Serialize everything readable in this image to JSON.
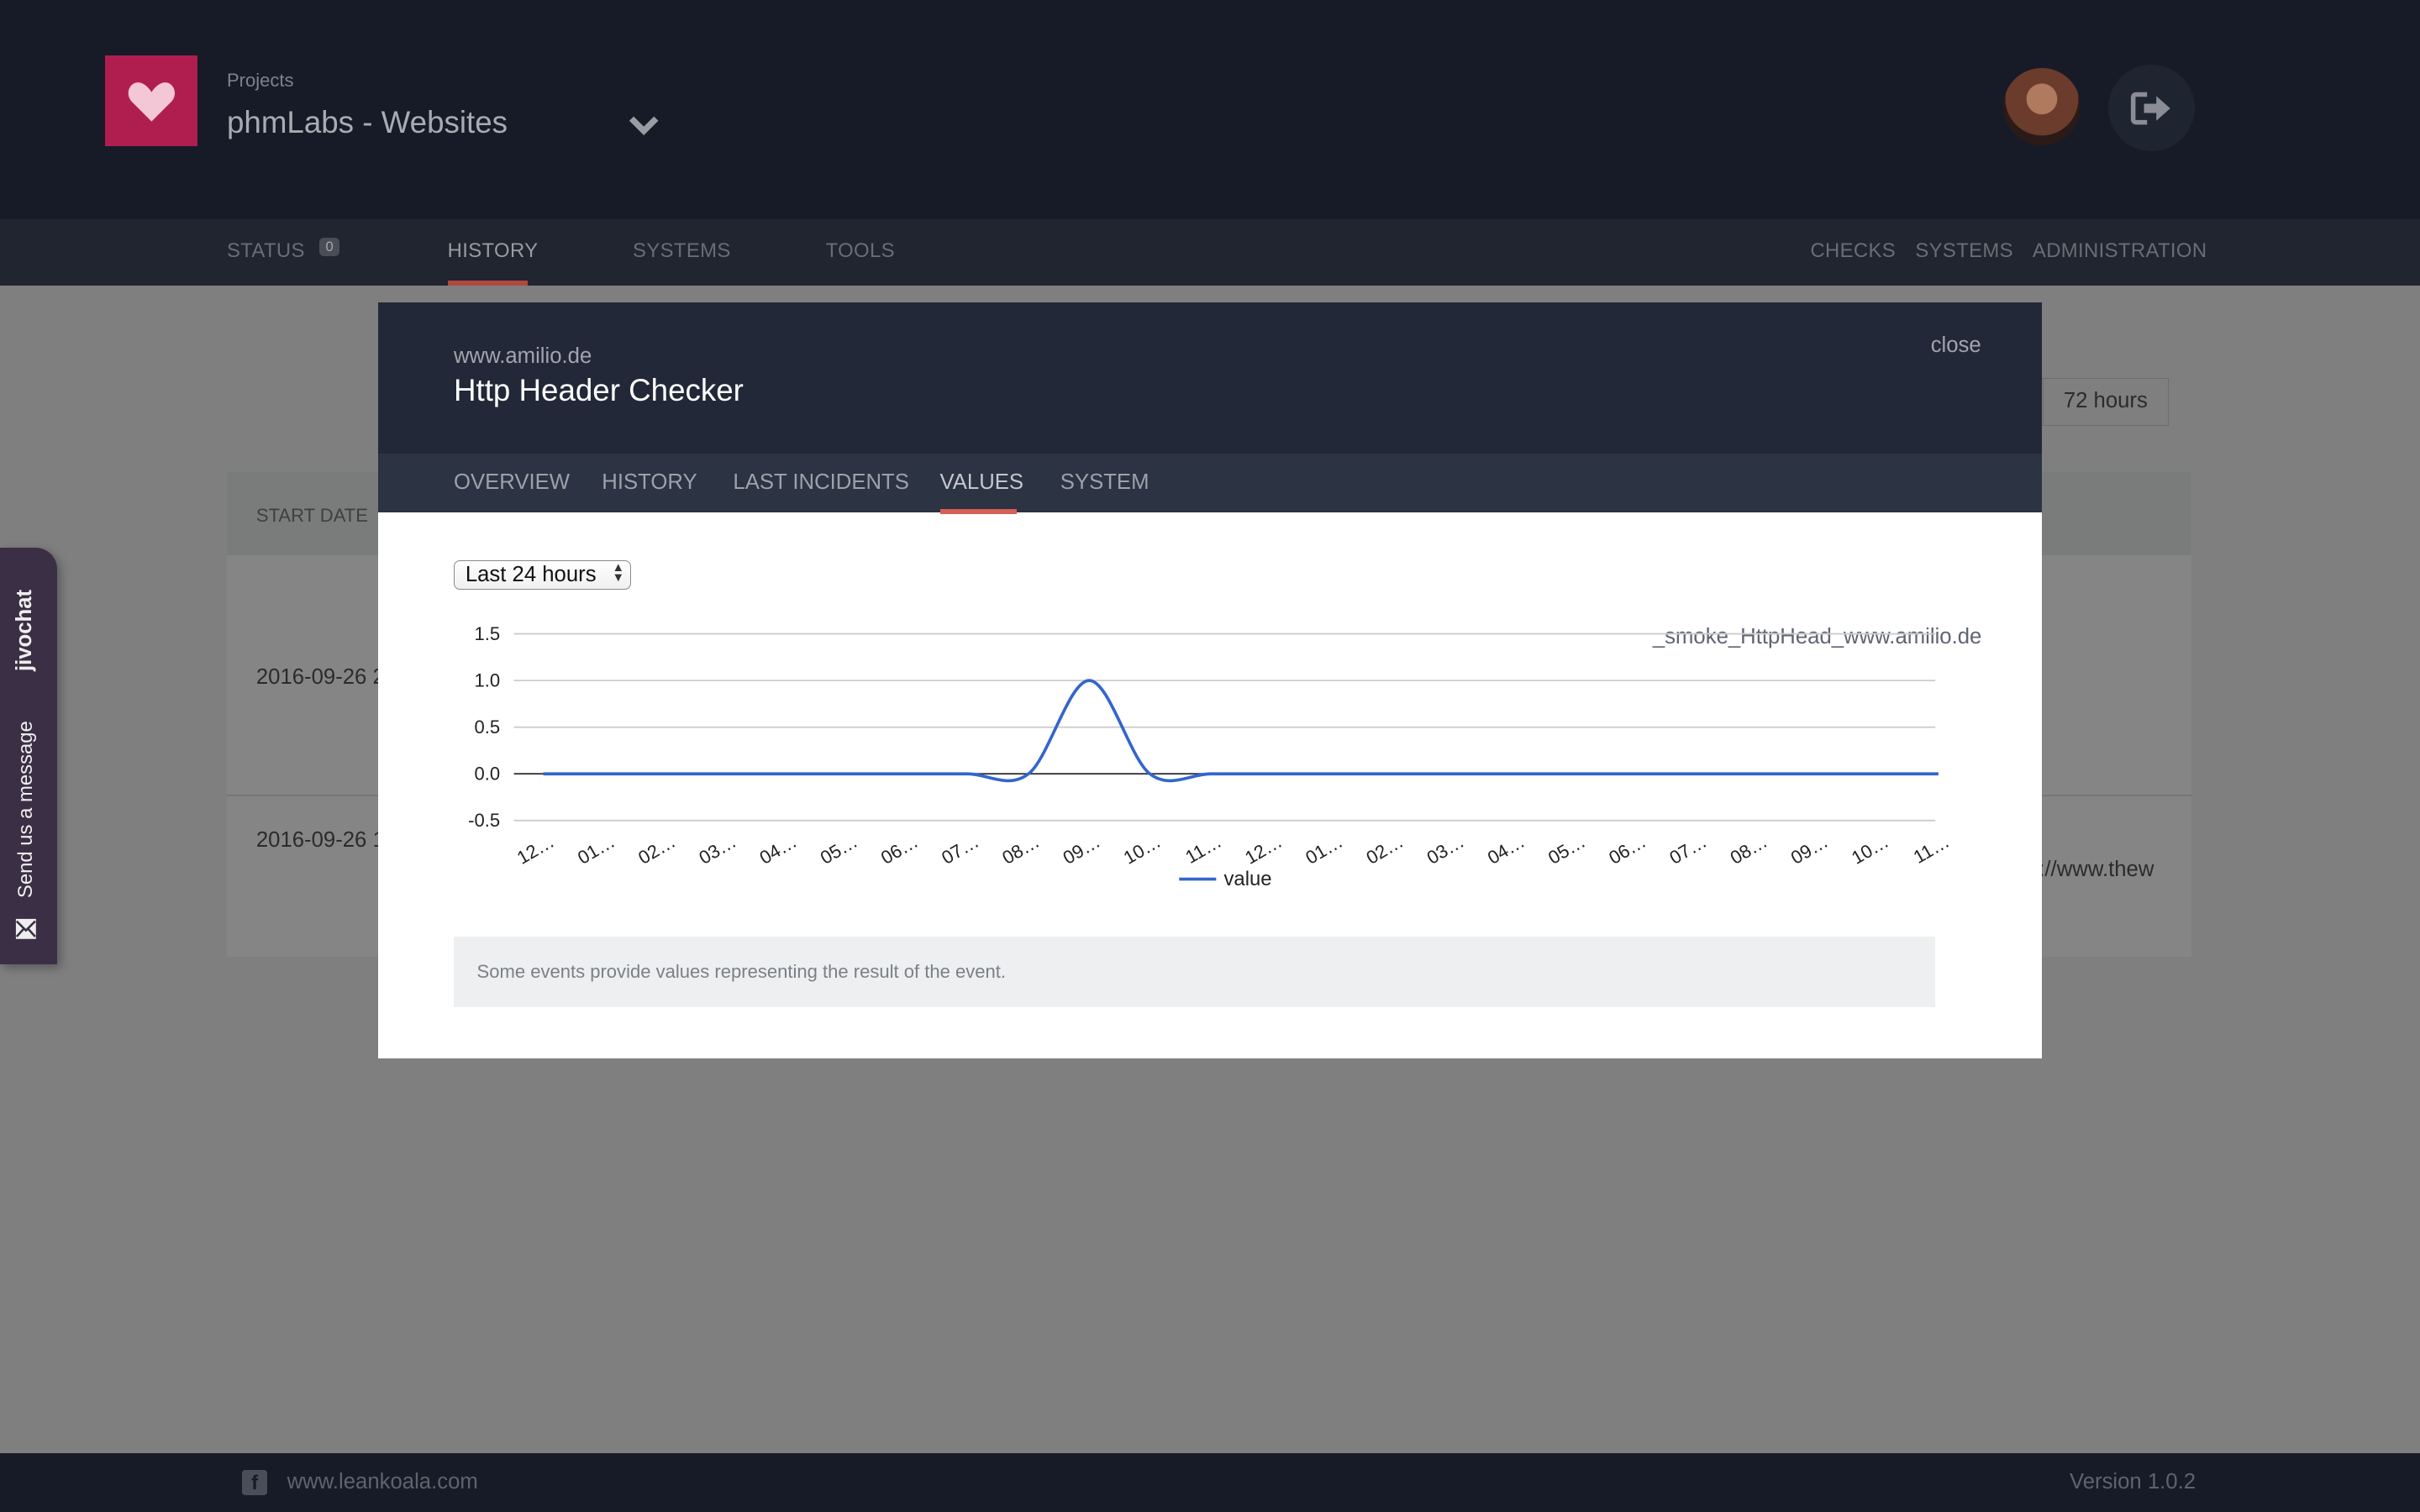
{
  "header": {
    "projects_label": "Projects",
    "project_name": "phmLabs - Websites",
    "brand_color": "#b01e4f"
  },
  "nav": {
    "status": "STATUS",
    "status_badge": "0",
    "history": "HISTORY",
    "systems": "SYSTEMS",
    "tools": "TOOLS",
    "checks": "CHECKS",
    "systems_right": "SYSTEMS",
    "administration": "ADMINISTRATION"
  },
  "background": {
    "column_start_date": "START DATE",
    "row1_date": "2016-09-26 2",
    "row2_date": "2016-09-26 1",
    "row2_url": "://www.thew",
    "range_partial": "s",
    "range_72": "72 hours"
  },
  "chat": {
    "brand": "jivochat",
    "send_message": "Send us a message"
  },
  "footer": {
    "link": "www.leankoala.com",
    "version": "Version 1.0.2"
  },
  "modal": {
    "domain": "www.amilio.de",
    "title": "Http Header Checker",
    "close": "close",
    "tabs": [
      "OVERVIEW",
      "HISTORY",
      "LAST INCIDENTS",
      "VALUES",
      "SYSTEM"
    ],
    "active_tab": "VALUES",
    "identifier": "_smoke_HttpHead_www.amilio.de",
    "range_select": "Last 24 hours",
    "info_text": "Some events provide values representing the result of the event."
  },
  "chart_data": {
    "type": "line",
    "title": "",
    "xlabel": "",
    "ylabel": "",
    "ylim": [
      -0.5,
      1.5
    ],
    "yticks": [
      "1.5",
      "1.0",
      "0.5",
      "0.0",
      "-0.5"
    ],
    "categories": [
      "12…",
      "01…",
      "02…",
      "03…",
      "04…",
      "05…",
      "06…",
      "07…",
      "08…",
      "09…",
      "10…",
      "11…",
      "12…",
      "01…",
      "02…",
      "03…",
      "04…",
      "05…",
      "06…",
      "07…",
      "08…",
      "09…",
      "10…",
      "11…"
    ],
    "series": [
      {
        "name": "value",
        "color": "#3366cc",
        "values": [
          0,
          0,
          0,
          0,
          0,
          0,
          0,
          0,
          0,
          1,
          0,
          0,
          0,
          0,
          0,
          0,
          0,
          0,
          0,
          0,
          0,
          0,
          0,
          0
        ]
      }
    ],
    "grid": true,
    "legend": "bottom"
  }
}
